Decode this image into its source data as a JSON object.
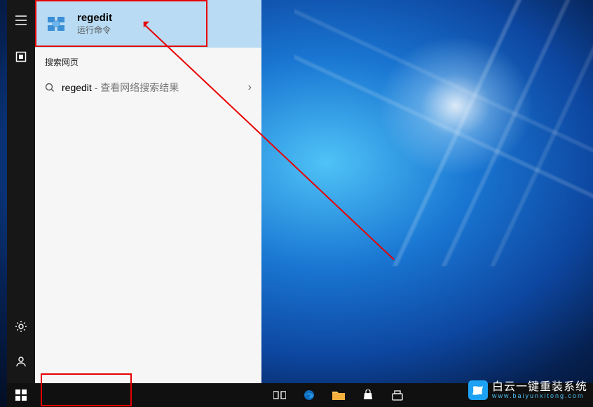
{
  "rail": {
    "menu_name": "menu-icon",
    "pinned_name": "pinned-app-icon",
    "settings_name": "settings-icon",
    "user_name": "user-icon"
  },
  "panel": {
    "best_match": {
      "title": "regedit",
      "subtitle": "运行命令"
    },
    "web_section_header": "搜索网页",
    "web_result": {
      "query": "regedit",
      "suffix": " - 查看网络搜索结果",
      "chevron": "›"
    }
  },
  "search": {
    "value": "regedit"
  },
  "watermark": {
    "text": "白云一键重装系统",
    "url": "www.baiyunxitong.com"
  }
}
